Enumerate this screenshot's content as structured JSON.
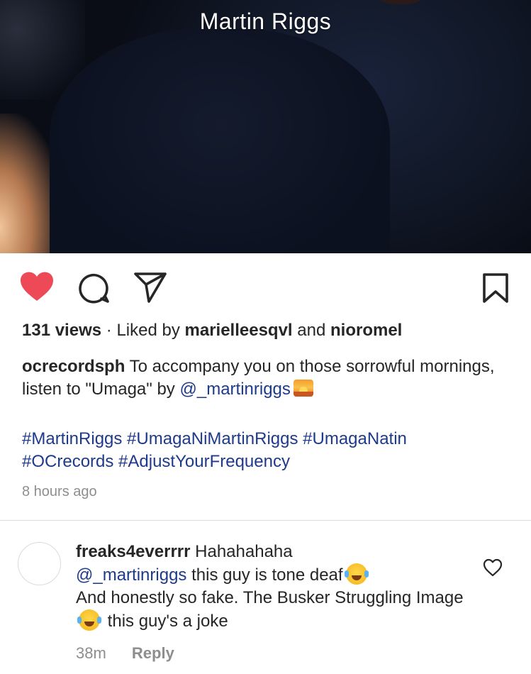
{
  "video": {
    "caption": "Martin Riggs"
  },
  "actions": {
    "like_icon": "heart-filled-icon",
    "comment_icon": "comment-icon",
    "share_icon": "send-icon",
    "save_icon": "bookmark-icon",
    "like_color": "#ed4956"
  },
  "stats": {
    "views": "131 views",
    "separator": "·",
    "liked_by_prefix": "Liked by",
    "liked_user_1": "marielleesqvl",
    "conjunction": "and",
    "liked_user_2": "nioromel"
  },
  "post": {
    "username": "ocrecordsph",
    "caption_text": "To accompany you on those sorrowful mornings, listen to \"Umaga\" by",
    "caption_mention": "@_martinriggs",
    "caption_emoji": "sunrise-emoji",
    "hashtags_line1": "#MartinRiggs #UmagaNiMartinRiggs #UmagaNatin",
    "hashtags_line2": "#OCrecords #AdjustYourFrequency",
    "timestamp": "8 hours ago"
  },
  "comment": {
    "username": "freaks4everrrr",
    "text_1": "Hahahahaha",
    "mention": "@_martinriggs",
    "text_2": "this guy is tone deaf",
    "text_3": "And honestly so fake. The Busker Struggling Image",
    "text_4": "this guy's a joke",
    "emoji": "face-with-tears-of-joy-emoji",
    "time": "38m",
    "reply_label": "Reply"
  },
  "colors": {
    "link": "#1e3a8a",
    "muted": "#8e8e8e",
    "text": "#262626"
  }
}
